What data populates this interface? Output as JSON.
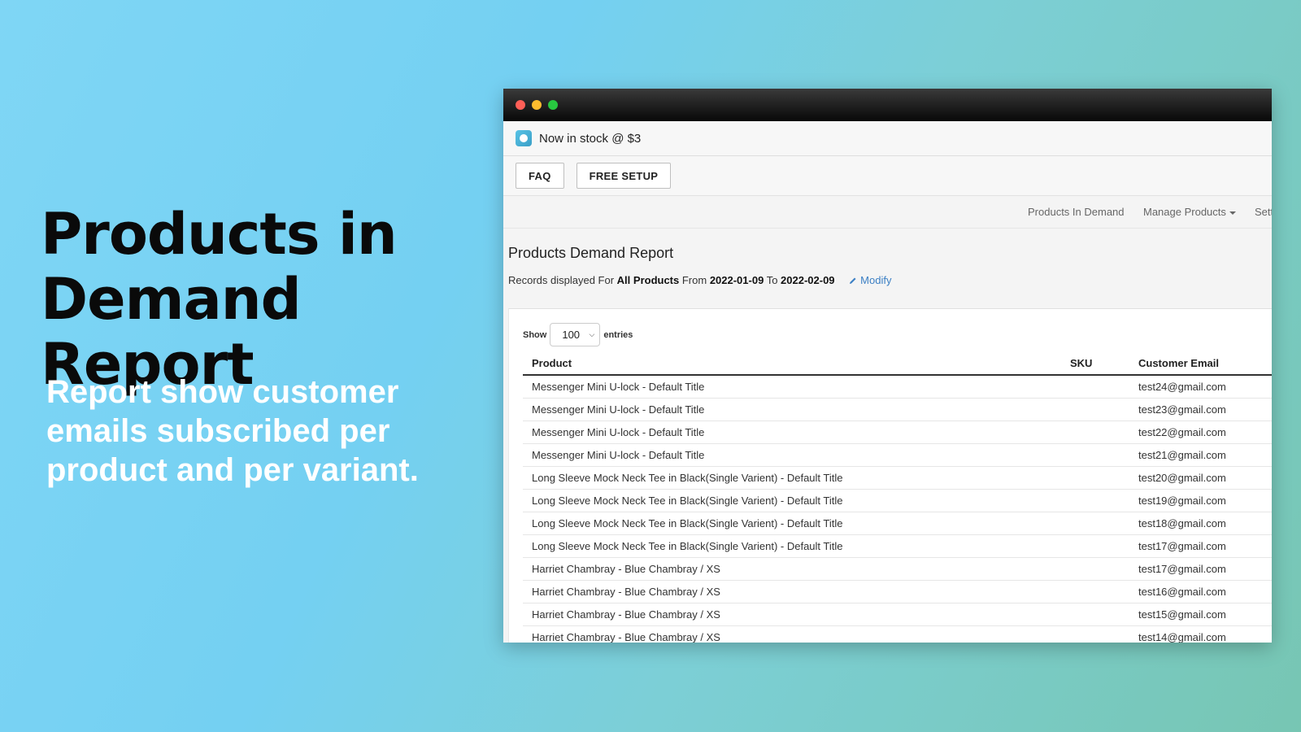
{
  "hero": {
    "title": "Products in Demand Report",
    "subtitle": "Report show customer emails subscribed per product and per variant."
  },
  "app": {
    "name": "Now in stock @ $3",
    "buttons": {
      "faq": "FAQ",
      "free_setup": "FREE SETUP"
    }
  },
  "nav": {
    "products_in_demand": "Products In Demand",
    "manage_products": "Manage Products",
    "settings_truncated": "Sett"
  },
  "report": {
    "title": "Products Demand Report",
    "records_prefix": "Records displayed For ",
    "scope": "All Products",
    "from_label": " From ",
    "from_date": "2022-01-09",
    "to_label": " To ",
    "to_date": "2022-02-09",
    "modify": "Modify"
  },
  "table_controls": {
    "show_label": "Show",
    "entries_value": "100",
    "entries_label": "entries"
  },
  "table": {
    "headers": [
      "Product",
      "SKU",
      "Customer Email"
    ],
    "rows": [
      [
        "Messenger Mini U-lock - Default Title",
        "",
        "test24@gmail.com"
      ],
      [
        "Messenger Mini U-lock - Default Title",
        "",
        "test23@gmail.com"
      ],
      [
        "Messenger Mini U-lock - Default Title",
        "",
        "test22@gmail.com"
      ],
      [
        "Messenger Mini U-lock - Default Title",
        "",
        "test21@gmail.com"
      ],
      [
        "Long Sleeve Mock Neck Tee in Black(Single Varient) - Default Title",
        "",
        "test20@gmail.com"
      ],
      [
        "Long Sleeve Mock Neck Tee in Black(Single Varient) - Default Title",
        "",
        "test19@gmail.com"
      ],
      [
        "Long Sleeve Mock Neck Tee in Black(Single Varient) - Default Title",
        "",
        "test18@gmail.com"
      ],
      [
        "Long Sleeve Mock Neck Tee in Black(Single Varient) - Default Title",
        "",
        "test17@gmail.com"
      ],
      [
        "Harriet Chambray - Blue Chambray / XS",
        "",
        "test17@gmail.com"
      ],
      [
        "Harriet Chambray - Blue Chambray / XS",
        "",
        "test16@gmail.com"
      ],
      [
        "Harriet Chambray - Blue Chambray / XS",
        "",
        "test15@gmail.com"
      ],
      [
        "Harriet Chambray - Blue Chambray / XS",
        "",
        "test14@gmail.com"
      ]
    ]
  },
  "colors": {
    "link": "#3b7fc4",
    "titlebar": "#111111",
    "background_start": "#7fd6f5",
    "background_end": "#77c6b3"
  }
}
